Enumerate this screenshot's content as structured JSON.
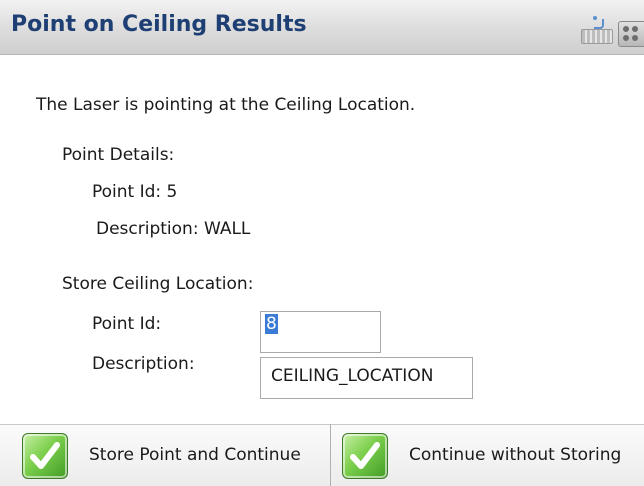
{
  "window": {
    "title": "Point on Ceiling Results"
  },
  "toolbar": {
    "icons": [
      "keyboard-icon",
      "grid-menu-icon"
    ]
  },
  "main": {
    "message": "The Laser is pointing at the Ceiling Location.",
    "point_details": {
      "heading": "Point Details:",
      "point_id": "Point Id: 5",
      "description": "Description: WALL"
    },
    "store_ceiling": {
      "heading": "Store Ceiling Location:",
      "point_id_label": "Point Id:",
      "point_id_value": "8",
      "description_label": "Description:",
      "description_value": "CEILING_LOCATION"
    }
  },
  "footer": {
    "store_button": "Store Point and Continue",
    "continue_button": "Continue without Storing",
    "accent_color": "#4caf2a"
  }
}
